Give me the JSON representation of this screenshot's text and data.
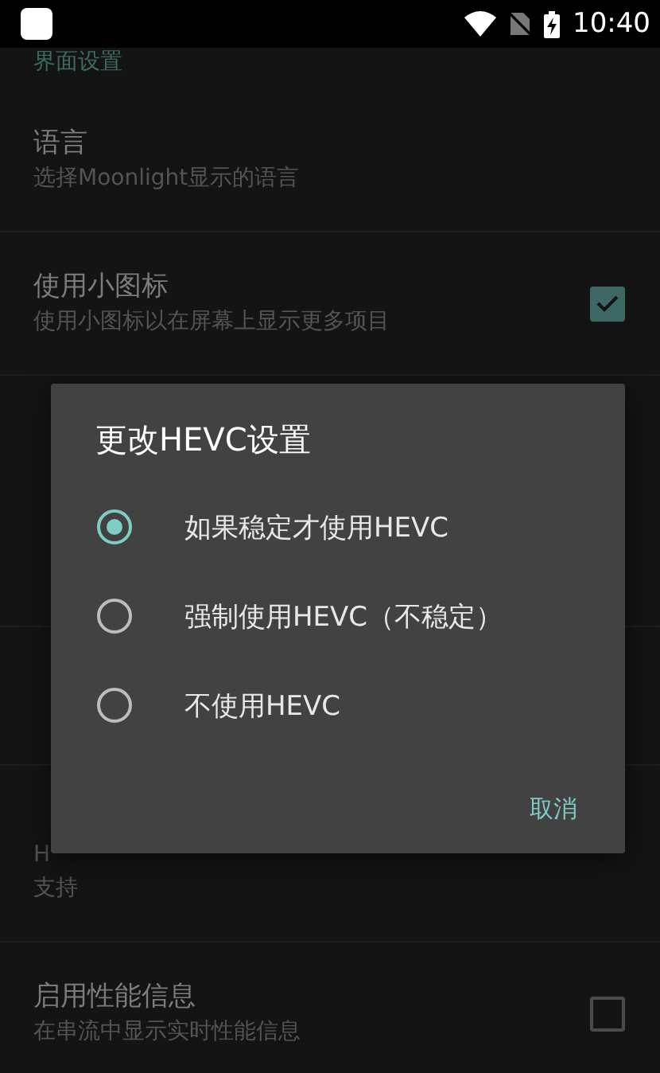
{
  "status_bar": {
    "time": "10:40"
  },
  "settings": [
    {
      "kind": "category",
      "title": "界面设置"
    },
    {
      "kind": "preference",
      "title": "语言",
      "summary": [
        "选择Moonlight显示的语言"
      ]
    },
    {
      "kind": "preference",
      "title": "使用小图标",
      "summary": [
        "使用小图标以在屏幕上显示更多项目"
      ],
      "checkbox": {
        "checked": true
      }
    },
    {
      "kind": "covered"
    },
    {
      "kind": "covered"
    },
    {
      "kind": "preference",
      "summary": [
        "H",
        "支持"
      ]
    },
    {
      "kind": "preference",
      "title": "启用性能信息",
      "summary": [
        "在串流中显示实时性能信息"
      ],
      "checkbox": {
        "checked": false
      }
    }
  ],
  "dialog": {
    "title": "更改HEVC设置",
    "options": [
      {
        "label": "如果稳定才使用HEVC",
        "selected": true
      },
      {
        "label": "强制使用HEVC（不稳定）",
        "selected": false
      },
      {
        "label": "不使用HEVC",
        "selected": false
      }
    ],
    "buttons": [
      "取消"
    ]
  }
}
